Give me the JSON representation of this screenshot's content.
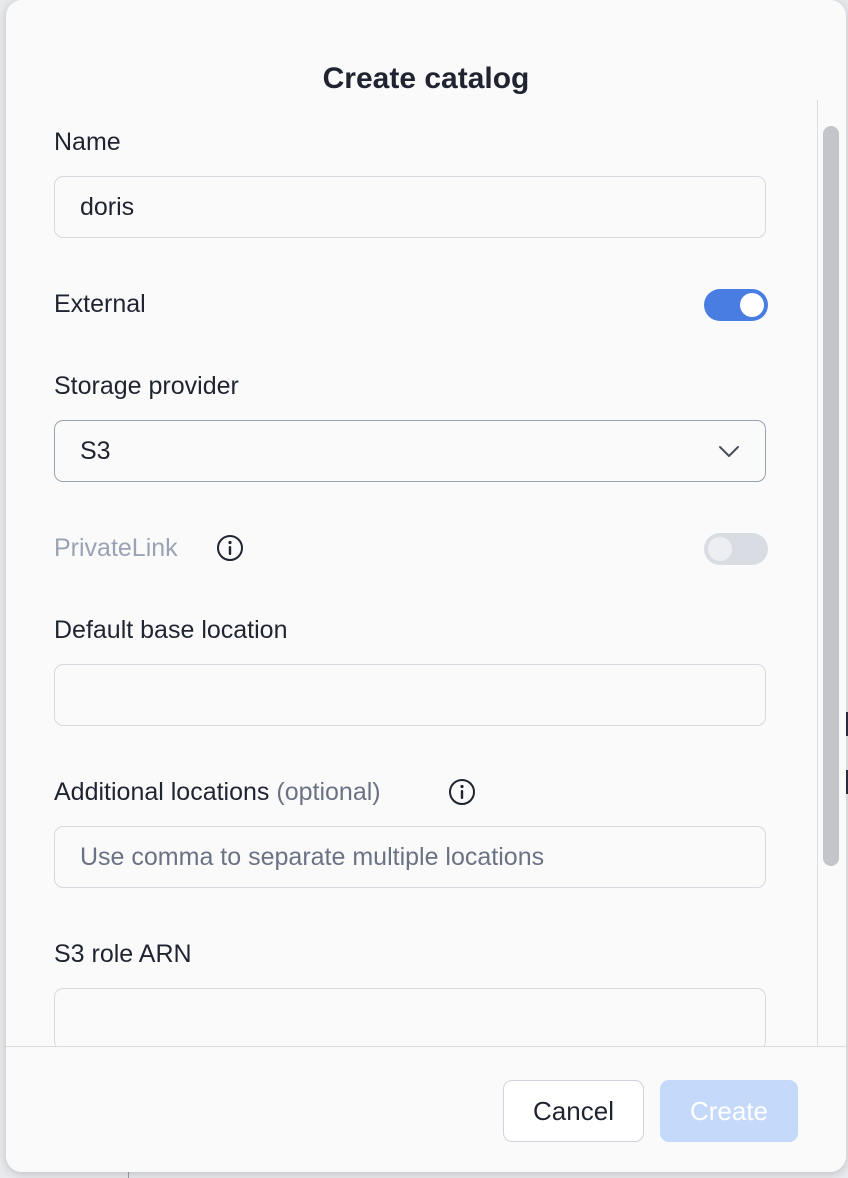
{
  "dialog": {
    "title": "Create catalog",
    "name": {
      "label": "Name",
      "value": "doris"
    },
    "external": {
      "label": "External",
      "enabled": true
    },
    "storage_provider": {
      "label": "Storage provider",
      "value": "S3"
    },
    "private_link": {
      "label": "PrivateLink",
      "enabled": false,
      "disabled": true
    },
    "default_base_location": {
      "label": "Default base location",
      "value": ""
    },
    "additional_locations": {
      "label": "Additional locations",
      "optional": "(optional)",
      "placeholder": "Use comma to separate multiple locations"
    },
    "s3_role_arn": {
      "label": "S3 role ARN",
      "value": ""
    },
    "cancel_label": "Cancel",
    "create_label": "Create"
  },
  "colors": {
    "accent": "#4a7de2",
    "create_disabled_bg": "#c5d9fb",
    "text": "#1f2430",
    "muted": "#6b7284"
  },
  "icons": [
    "info-icon",
    "chevron-down-icon"
  ]
}
